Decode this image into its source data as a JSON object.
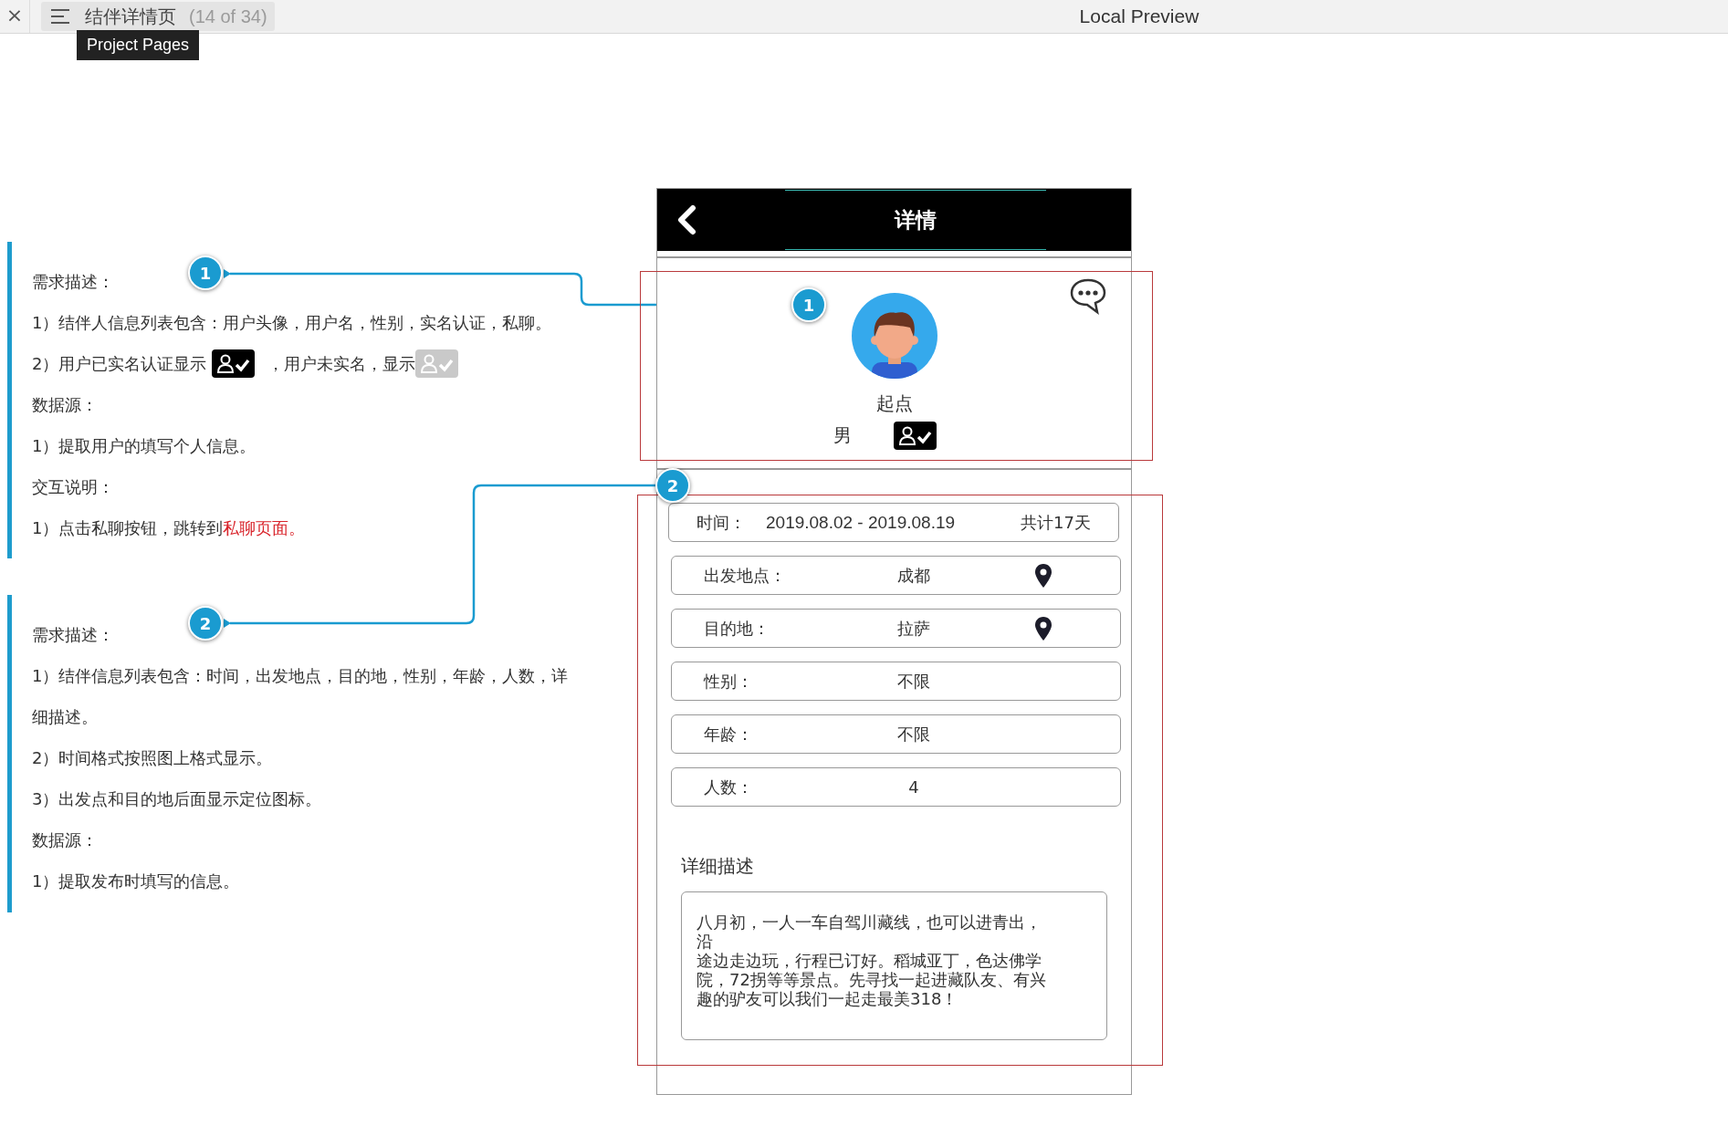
{
  "toolbar": {
    "close": "×",
    "page_title": "结伴详情页",
    "page_count": "(14 of 34)",
    "preview_label": "Local Preview",
    "tooltip": "Project Pages"
  },
  "annotations": [
    {
      "marker": "1",
      "lines": [
        {
          "kind": "heading",
          "text": "需求描述："
        },
        {
          "kind": "text",
          "text": "1）结伴人信息列表包含：用户头像，用户名，性别，实名认证，私聊。"
        },
        {
          "kind": "badges",
          "segments": [
            {
              "kind": "text",
              "text": "2）用户已实名认证显示"
            },
            {
              "kind": "badge",
              "verified": true
            },
            {
              "kind": "text",
              "text": "，用户未实名，显示"
            },
            {
              "kind": "badge",
              "verified": false
            }
          ]
        },
        {
          "kind": "heading",
          "text": "数据源："
        },
        {
          "kind": "text",
          "text": "1）提取用户的填写个人信息。"
        },
        {
          "kind": "heading",
          "text": "交互说明："
        },
        {
          "kind": "link",
          "text": "1）点击私聊按钮，跳转到",
          "link": "私聊页面。"
        }
      ]
    },
    {
      "marker": "2",
      "lines": [
        {
          "kind": "heading",
          "text": "需求描述："
        },
        {
          "kind": "text",
          "text": "1）结伴信息列表包含：时间，出发地点，目的地，性别，年龄，人数，详细描述。"
        },
        {
          "kind": "text",
          "text": "2）时间格式按照图上格式显示。"
        },
        {
          "kind": "text",
          "text": "3）出发点和目的地后面显示定位图标。"
        },
        {
          "kind": "heading",
          "text": "数据源："
        },
        {
          "kind": "text",
          "text": "1）提取发布时填写的信息。"
        }
      ]
    }
  ],
  "phone": {
    "title": "详情",
    "profile": {
      "callout": "1",
      "name": "起点",
      "gender": "男",
      "verified": true
    },
    "details_callout": "2",
    "rows": [
      {
        "kind": "time",
        "label": "时间：",
        "value": "2019.08.02 - 2019.08.19",
        "extra": "共计17天"
      },
      {
        "kind": "field",
        "label": "出发地点：",
        "value": "成都",
        "pin": true
      },
      {
        "kind": "field",
        "label": "目的地：",
        "value": "拉萨",
        "pin": true
      },
      {
        "kind": "field",
        "label": "性别：",
        "value": "不限",
        "pin": false
      },
      {
        "kind": "field",
        "label": "年龄：",
        "value": "不限",
        "pin": false
      },
      {
        "kind": "field",
        "label": "人数：",
        "value": "4",
        "pin": false
      }
    ],
    "description_title": "详细描述",
    "description": [
      "八月初，一人一车自驾川藏线，也可以进青出，沿",
      "途边走边玩，行程已订好。稻城亚丁，色达佛学院，72拐等等景点。先寻找一起进藏队友、有兴趣的驴友可以我们一起走最美318！"
    ]
  }
}
